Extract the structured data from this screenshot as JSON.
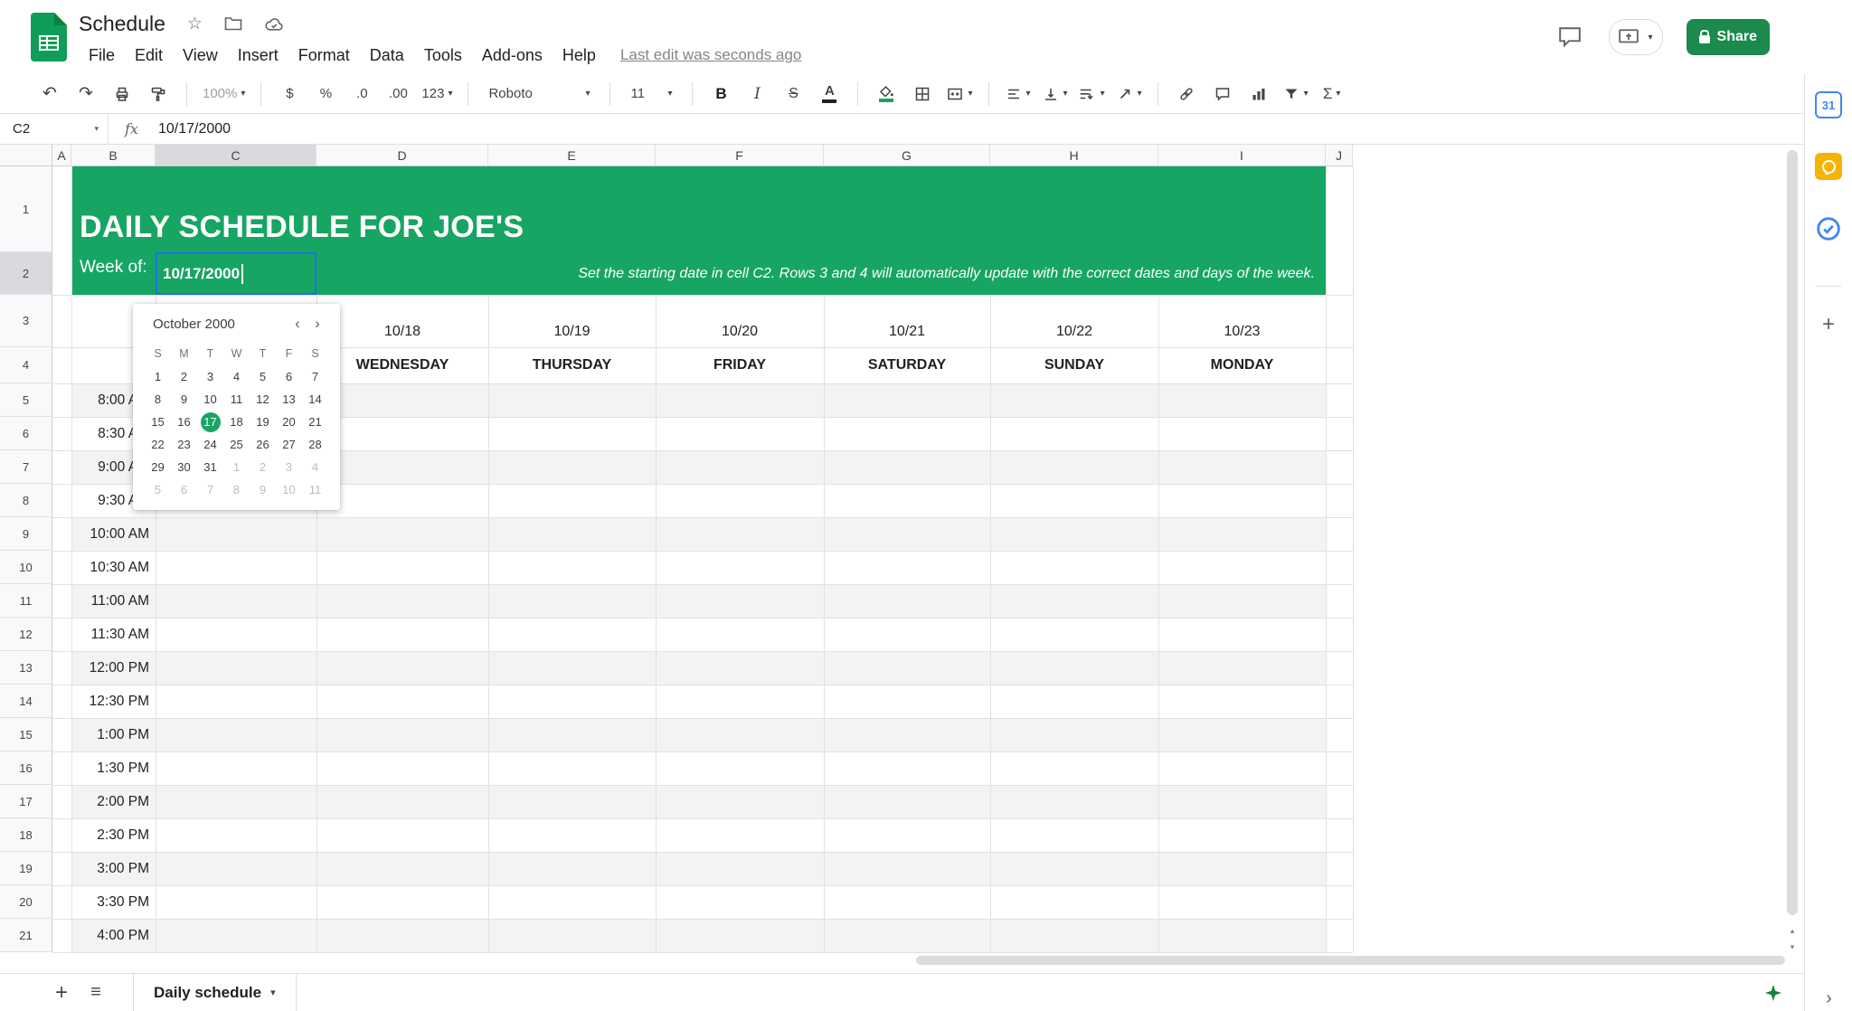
{
  "app": {
    "title": "Schedule",
    "menu": [
      "File",
      "Edit",
      "View",
      "Insert",
      "Format",
      "Data",
      "Tools",
      "Add-ons",
      "Help"
    ],
    "last_edit": "Last edit was seconds ago",
    "share_label": "Share"
  },
  "toolbar": {
    "zoom": "100%",
    "currency": "$",
    "percent": "%",
    "decrease_decimal": ".0",
    "increase_decimal": ".00",
    "number_format": "123",
    "font_name": "Roboto",
    "font_size": "11",
    "bold": "B",
    "italic": "I",
    "strikethrough": "S",
    "text_color": "A",
    "functions": "Σ"
  },
  "formula_bar": {
    "name_box": "C2",
    "fx_label": "fx",
    "value": "10/17/2000"
  },
  "grid": {
    "columns": [
      "A",
      "B",
      "C",
      "D",
      "E",
      "F",
      "G",
      "H",
      "I",
      "J"
    ],
    "rows": [
      "1",
      "2",
      "3",
      "4",
      "5",
      "6",
      "7",
      "8",
      "9",
      "10",
      "11",
      "12",
      "13",
      "14",
      "15",
      "16",
      "17",
      "18",
      "19",
      "20",
      "21"
    ],
    "banner": {
      "title": "DAILY SCHEDULE FOR JOE'S",
      "week_of_label": "Week of:",
      "date_value": "10/17/2000",
      "instruction": "Set the starting date in cell C2. Rows 3 and 4 will automatically update with the correct dates and days of the week."
    },
    "dates": [
      "10/18",
      "10/19",
      "10/20",
      "10/21",
      "10/22",
      "10/23"
    ],
    "days": [
      "WEDNESDAY",
      "THURSDAY",
      "FRIDAY",
      "SATURDAY",
      "SUNDAY",
      "MONDAY"
    ],
    "times": [
      "8:00 AM",
      "8:30 AM",
      "9:00 AM",
      "9:30 AM",
      "10:00 AM",
      "10:30 AM",
      "11:00 AM",
      "11:30 AM",
      "12:00 PM",
      "12:30 PM",
      "1:00 PM",
      "1:30 PM",
      "2:00 PM",
      "2:30 PM",
      "3:00 PM",
      "3:30 PM",
      "4:00 PM"
    ]
  },
  "datepicker": {
    "month_label": "October 2000",
    "prev": "‹",
    "next": "›",
    "day_headers": [
      "S",
      "M",
      "T",
      "W",
      "T",
      "F",
      "S"
    ],
    "weeks": [
      [
        {
          "t": "1"
        },
        {
          "t": "2"
        },
        {
          "t": "3"
        },
        {
          "t": "4"
        },
        {
          "t": "5"
        },
        {
          "t": "6"
        },
        {
          "t": "7"
        }
      ],
      [
        {
          "t": "8"
        },
        {
          "t": "9"
        },
        {
          "t": "10"
        },
        {
          "t": "11"
        },
        {
          "t": "12"
        },
        {
          "t": "13"
        },
        {
          "t": "14"
        }
      ],
      [
        {
          "t": "15"
        },
        {
          "t": "16"
        },
        {
          "t": "17",
          "selected": true
        },
        {
          "t": "18"
        },
        {
          "t": "19"
        },
        {
          "t": "20"
        },
        {
          "t": "21"
        }
      ],
      [
        {
          "t": "22"
        },
        {
          "t": "23"
        },
        {
          "t": "24"
        },
        {
          "t": "25"
        },
        {
          "t": "26"
        },
        {
          "t": "27"
        },
        {
          "t": "28"
        }
      ],
      [
        {
          "t": "29"
        },
        {
          "t": "30"
        },
        {
          "t": "31"
        },
        {
          "t": "1",
          "muted": true
        },
        {
          "t": "2",
          "muted": true
        },
        {
          "t": "3",
          "muted": true
        },
        {
          "t": "4",
          "muted": true
        }
      ],
      [
        {
          "t": "5",
          "muted": true
        },
        {
          "t": "6",
          "muted": true
        },
        {
          "t": "7",
          "muted": true
        },
        {
          "t": "8",
          "muted": true
        },
        {
          "t": "9",
          "muted": true
        },
        {
          "t": "10",
          "muted": true
        },
        {
          "t": "11",
          "muted": true
        }
      ]
    ]
  },
  "sheet_bar": {
    "tab_label": "Daily schedule"
  },
  "side_panel": {
    "calendar_day": "31"
  },
  "icons": {
    "star": "☆",
    "undo": "↶",
    "redo": "↷",
    "dropdown_caret": "▾",
    "add": "+",
    "all_sheets": "≡",
    "panel_collapse": "›",
    "scroll_up": "▴",
    "scroll_down": "▾"
  },
  "colors": {
    "banner_green": "#17a563",
    "share_green": "#1b8a4c",
    "selection_blue": "#1a73e8",
    "band_grey": "#f3f3f3"
  }
}
